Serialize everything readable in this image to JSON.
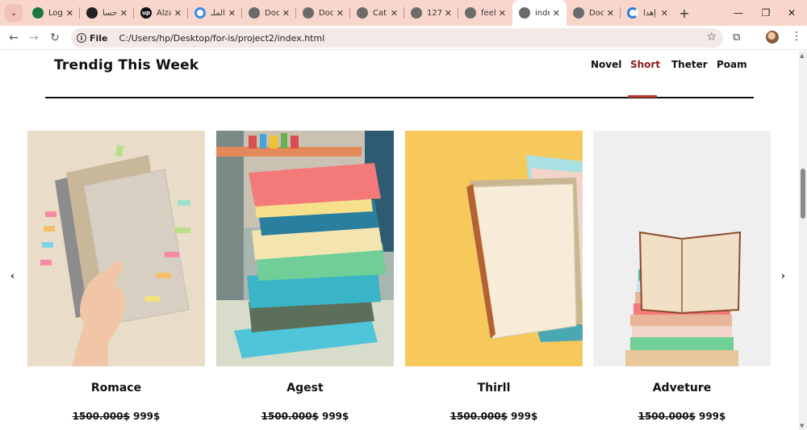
{
  "browser": {
    "tabs": [
      {
        "title": "Log",
        "color": "#1e7a3c",
        "glyph": "◐",
        "active": false
      },
      {
        "title": "حسا",
        "color": "#222222",
        "glyph": "●",
        "active": false
      },
      {
        "title": "Alza",
        "color": "#111111",
        "glyph": "up",
        "active": false
      },
      {
        "title": "الملـ",
        "color": "#3b8fe0",
        "glyph": "○",
        "active": false
      },
      {
        "title": "Doc",
        "color": "#6b6b6b",
        "glyph": "◍",
        "active": false
      },
      {
        "title": "Doc",
        "color": "#6b6b6b",
        "glyph": "◍",
        "active": false
      },
      {
        "title": "Cat",
        "color": "#6b6b6b",
        "glyph": "◍",
        "active": false
      },
      {
        "title": "127",
        "color": "#6b6b6b",
        "glyph": "◍",
        "active": false
      },
      {
        "title": "feel",
        "color": "#6b6b6b",
        "glyph": "◍",
        "active": false
      },
      {
        "title": "inde",
        "color": "#6b6b6b",
        "glyph": "◍",
        "active": true
      },
      {
        "title": "Doc",
        "color": "#6b6b6b",
        "glyph": "◍",
        "active": false
      },
      {
        "title": "إهدا",
        "color": "#2f7fd8",
        "glyph": "◔",
        "active": false
      }
    ],
    "scheme": "File",
    "url": "C:/Users/hp/Desktop/for-is/project2/index.html"
  },
  "header": {
    "title": "Trendig This Week",
    "nav": [
      {
        "label": "Novel",
        "active": false
      },
      {
        "label": "Short",
        "active": true
      },
      {
        "label": "Theter",
        "active": false
      },
      {
        "label": "Poam",
        "active": false
      }
    ]
  },
  "cards": [
    {
      "name": "Romace",
      "old_price": "1500.000$",
      "new_price": "999$",
      "image": "hand-with-notebooks"
    },
    {
      "name": "Agest",
      "old_price": "1500.000$",
      "new_price": "999$",
      "image": "stack-of-books"
    },
    {
      "name": "Thirll",
      "old_price": "1500.000$",
      "new_price": "999$",
      "image": "flying-book-yellow"
    },
    {
      "name": "Adveture",
      "old_price": "1500.000$",
      "new_price": "999$",
      "image": "open-book-on-stack"
    }
  ],
  "colors": {
    "accent": "#c0392b",
    "active_nav": "#8b1a1a",
    "tabbar": "#f9d6cc"
  }
}
